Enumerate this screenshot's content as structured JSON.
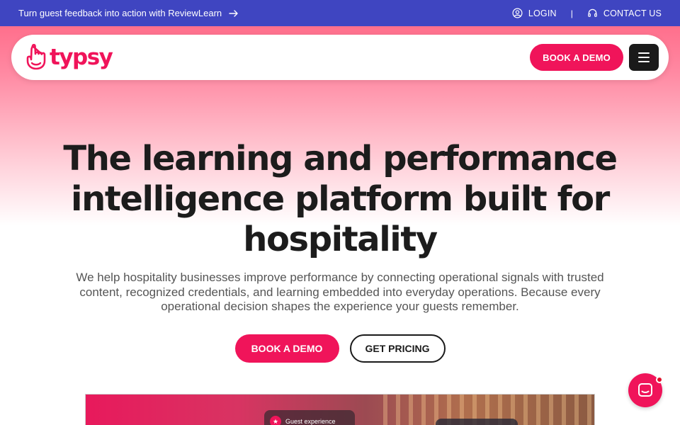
{
  "topbar": {
    "announcement": "Turn guest feedback into action with ReviewLearn",
    "announcement_icon": "arrow-right-icon",
    "login_label": "LOGIN",
    "login_icon": "user-circle-icon",
    "separator": "|",
    "contact_label": "CONTACT US",
    "contact_icon": "headset-icon"
  },
  "nav": {
    "logo_text": "typsy",
    "book_demo_label": "BOOK A DEMO",
    "menu_icon": "hamburger-menu-icon"
  },
  "hero": {
    "headline": "The learning and performance intelligence platform built for hospitality",
    "subtext": "We help hospitality businesses improve performance by connecting operational signals with trusted content, recognized credentials, and learning embedded into everyday operations. Because every operational decision shapes the experience your guests remember.",
    "primary_cta": "BOOK A DEMO",
    "secondary_cta": "GET PRICING"
  },
  "preview": {
    "card_label": "Guest experience",
    "card_icon": "star-icon"
  },
  "chat": {
    "icon": "chat-icon"
  },
  "colors": {
    "brand_pink": "#f0145a",
    "topbar_blue": "#3f45c1",
    "dark": "#1a1a1a"
  }
}
